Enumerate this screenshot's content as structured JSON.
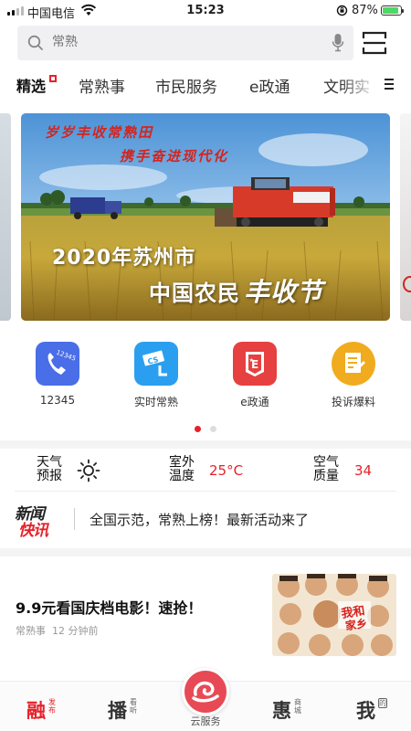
{
  "status_bar": {
    "carrier": "中国电信",
    "time": "15:23",
    "battery": "87%",
    "battery_level": 0.87
  },
  "search": {
    "placeholder": "常熟"
  },
  "tabs": [
    {
      "label": "精选",
      "active": true
    },
    {
      "label": "常熟事"
    },
    {
      "label": "市民服务"
    },
    {
      "label": "e政通"
    },
    {
      "label": "文明实"
    }
  ],
  "banner": {
    "line1": "岁岁丰收常熟田",
    "line2": "携手奋进现代化",
    "line3": "2020年苏州市",
    "line4a": "中国农民",
    "line4b": "丰收节"
  },
  "quick_icons": [
    {
      "label": "12345",
      "icon": "phone-12345-icon",
      "color": "#4a6ee8"
    },
    {
      "label": "实时常熟",
      "icon": "camera-cs-icon",
      "color": "#2a9ff0"
    },
    {
      "label": "e政通",
      "icon": "e-shield-icon",
      "color": "#e74040"
    },
    {
      "label": "投诉爆料",
      "icon": "document-icon",
      "color": "#f0ac1e"
    }
  ],
  "carousel_pages": 2,
  "weather": {
    "weather_label": "天气预报",
    "weather_icon": "sun-icon",
    "temp_label": "室外温度",
    "temp_value": "25°C",
    "aq_label": "空气质量",
    "aq_value": "34"
  },
  "news_flash": {
    "logo_top": "新闻",
    "logo_bottom": "快讯",
    "text": "全国示范，常熟上榜！最新活动来了"
  },
  "article": {
    "title": "9.9元看国庆档电影！速抢！",
    "source": "常熟事",
    "time": "12 分钟前"
  },
  "bottom_nav": [
    {
      "big": "融",
      "small": "发布",
      "active": true
    },
    {
      "big": "播",
      "small": "看听"
    },
    {
      "label": "云服务"
    },
    {
      "big": "惠",
      "small": "商城"
    },
    {
      "big": "我",
      "small": "的"
    }
  ],
  "colors": {
    "accent": "#e6212a",
    "search_bg": "#f0f0f2"
  }
}
